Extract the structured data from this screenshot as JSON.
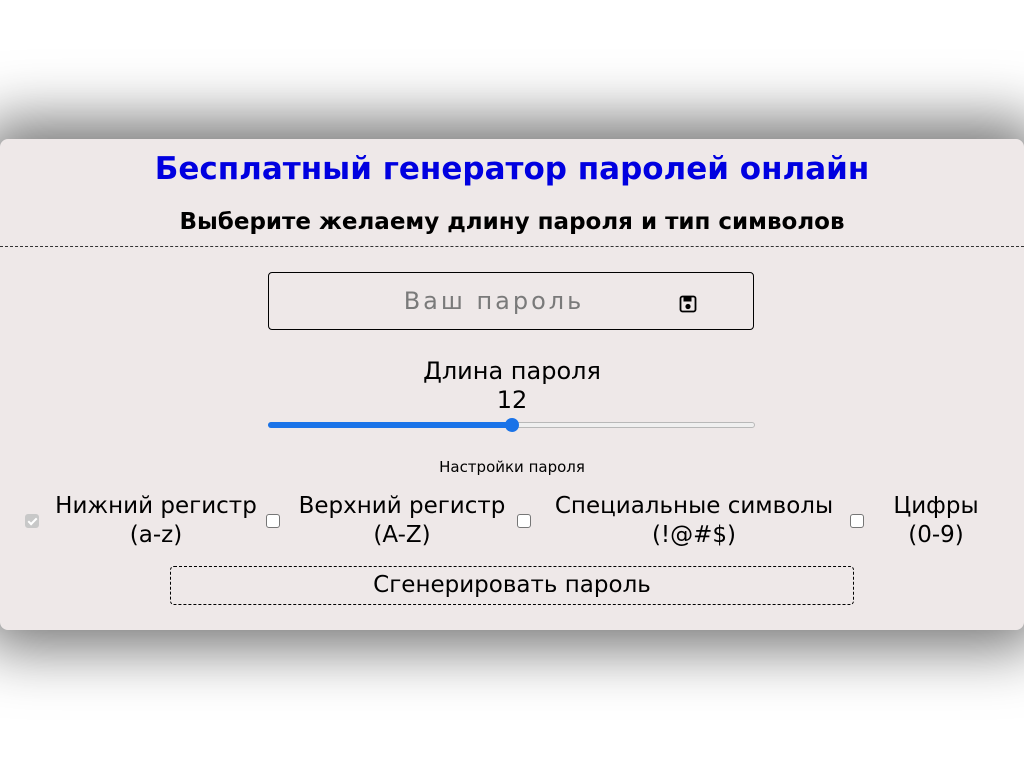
{
  "header": {
    "title": "Бесплатный генератор паролей онлайн",
    "subtitle": "Выберите желаему длину пароля и тип символов"
  },
  "password": {
    "value": "",
    "placeholder": "Ваш пароль",
    "save_icon": "floppy-disk-icon"
  },
  "length": {
    "label": "Длина пароля",
    "value": "12",
    "value_numeric": 12,
    "slider_fraction": 0.5
  },
  "settings": {
    "label": "Настройки пароля",
    "options": [
      {
        "line1": "Нижний регистр",
        "line2": "(a-z)",
        "checked": true,
        "disabled": true
      },
      {
        "line1": "Верхний регистр",
        "line2": "(A-Z)",
        "checked": false,
        "disabled": false
      },
      {
        "line1": "Специальные символы",
        "line2": "(!@#$)",
        "checked": false,
        "disabled": false
      },
      {
        "line1": "Цифры",
        "line2": "(0-9)",
        "checked": false,
        "disabled": false
      }
    ]
  },
  "actions": {
    "generate_label": "Сгенерировать пароль"
  },
  "colors": {
    "title": "#0000e0",
    "accent": "#1a73e8",
    "card_background": "#eee8e8"
  }
}
